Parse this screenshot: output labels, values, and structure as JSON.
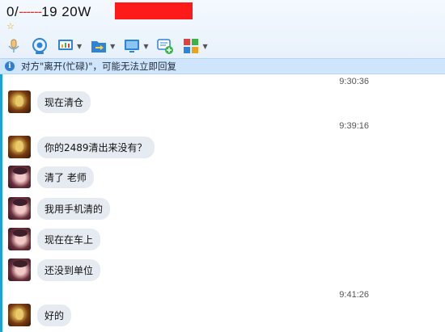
{
  "header": {
    "title_prefix": "0/",
    "title_masked": "------",
    "title_rest": "19  20W",
    "star": "☆"
  },
  "toolbar": {
    "items": [
      {
        "icon": "microphone-icon",
        "has_dropdown": false
      },
      {
        "icon": "video-camera-icon",
        "has_dropdown": false
      },
      {
        "icon": "screen-share-icon",
        "has_dropdown": true
      },
      {
        "icon": "file-transfer-icon",
        "has_dropdown": true
      },
      {
        "icon": "remote-desktop-icon",
        "has_dropdown": true
      },
      {
        "icon": "add-chat-icon",
        "has_dropdown": false
      },
      {
        "icon": "apps-grid-icon",
        "has_dropdown": true
      }
    ]
  },
  "notice": {
    "text": "对方\"离开(忙碌)\"，可能无法立即回复"
  },
  "chat": {
    "timestamps": [
      "9:30:36",
      "9:39:16",
      "9:41:26"
    ],
    "messages": [
      {
        "avatar": "a1",
        "text": "现在清仓"
      },
      {
        "avatar": "a1",
        "text": "你的2489清出来没有？"
      },
      {
        "avatar": "a2",
        "text": "清了 老师"
      },
      {
        "avatar": "a2",
        "text": "我用手机清的"
      },
      {
        "avatar": "a2",
        "text": "现在在车上"
      },
      {
        "avatar": "a2",
        "text": "还没到单位"
      },
      {
        "avatar": "a1",
        "text": "好的"
      }
    ]
  },
  "colors": {
    "accent": "#1aa3d9",
    "notice_bg": "#cfe5fb",
    "bubble_bg": "#e6ebf1",
    "redaction": "#ff1a1a"
  }
}
